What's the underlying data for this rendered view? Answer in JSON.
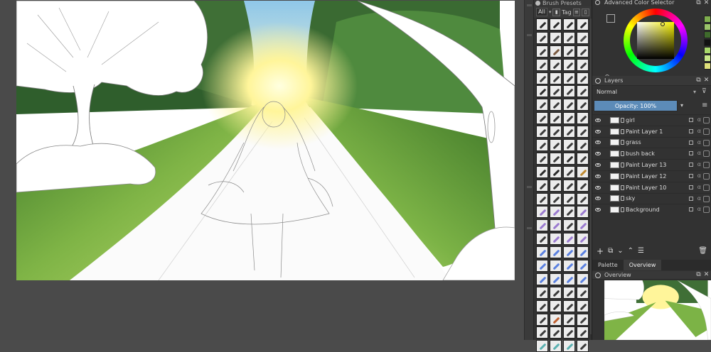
{
  "brush_docker": {
    "title": "Brush Presets",
    "filter_value": "All",
    "tag_label": "Tag",
    "brush_tip_colors": [
      "#2a2a2a",
      "#2a2a2a",
      "#2a2a2a",
      "#2a2a2a",
      "#3a3a3a",
      "#4a4a4a",
      "#4a4a4a",
      "#4a4a4a",
      "#3a3a3a",
      "#7a5a40",
      "#3a3a3a",
      "#3a3a3a",
      "#3a3a3a",
      "#3a3a3a",
      "#3a3a3a",
      "#3a3a3a",
      "#3a3a3a",
      "#3a3a3a",
      "#3a3a3a",
      "#3a3a3a",
      "#2a2a2a",
      "#3a3a3a",
      "#3a3a3a",
      "#3a3a3a",
      "#3a3a3a",
      "#3a3a3a",
      "#3a3a3a",
      "#3a3a3a",
      "#3a3a3a",
      "#3a3a3a",
      "#3a3a3a",
      "#3a3a3a",
      "#3a3a3a",
      "#3a3a3a",
      "#3a3a3a",
      "#3a3a3a",
      "#3a3a3a",
      "#3a3a3a",
      "#3a3a3a",
      "#3a3a3a",
      "#3a3a3a",
      "#3a3a3a",
      "#2a2a2a",
      "#3a3a3a",
      "#2a2a2a",
      "#2a2a2a",
      "#3a3a3a",
      "#c08a30",
      "#3a3a3a",
      "#3a3a3a",
      "#3a3a3a",
      "#3a3a3a",
      "#3a3a3a",
      "#3a3a3a",
      "#3a3a3a",
      "#3a3a3a",
      "#9a7ad0",
      "#9a7ad0",
      "#3a3a3a",
      "#9a7ad0",
      "#9a7ad0",
      "#9a7ad0",
      "#3a3a3a",
      "#9a7ad0",
      "#3a3a3a",
      "#9a7ad0",
      "#9a7ad0",
      "#9a7ad0",
      "#5a80e0",
      "#5a80e0",
      "#5a80e0",
      "#5a80e0",
      "#5a80e0",
      "#5a80e0",
      "#5a80e0",
      "#5a80e0",
      "#5a80e0",
      "#5a80e0",
      "#5a80e0",
      "#5a80e0",
      "#3a3a3a",
      "#3a3a3a",
      "#3a3a3a",
      "#3a3a3a",
      "#3a3a3a",
      "#3a3a3a",
      "#3a3a3a",
      "#3a3a3a",
      "#3a3a3a",
      "#c06030",
      "#3a3a3a",
      "#3a3a3a",
      "#3a3a3a",
      "#3a3a3a",
      "#3a3a3a",
      "#3a3a3a",
      "#5ab0b0",
      "#5ab0b0",
      "#5ab0b0",
      "#3a3a3a"
    ]
  },
  "color_selector": {
    "title": "Advanced Color Selector",
    "swatches": [
      "#7fae4e",
      "#9bc46a",
      "#3f6b2c",
      "#111111",
      "#a8d86a",
      "#c9e88a",
      "#dfe07a"
    ]
  },
  "layers": {
    "title": "Layers",
    "blend_mode": "Normal",
    "opacity": "Opacity:  100%",
    "items": [
      {
        "name": "girl"
      },
      {
        "name": "Paint Layer 1"
      },
      {
        "name": "grass"
      },
      {
        "name": "bush back"
      },
      {
        "name": "Paint Layer 13"
      },
      {
        "name": "Paint Layer 12"
      },
      {
        "name": "Paint Layer 10"
      },
      {
        "name": "sky"
      },
      {
        "name": "Background"
      }
    ]
  },
  "tabs": {
    "palette": "Palette",
    "overview": "Overview"
  },
  "overview": {
    "title": "Overview"
  }
}
